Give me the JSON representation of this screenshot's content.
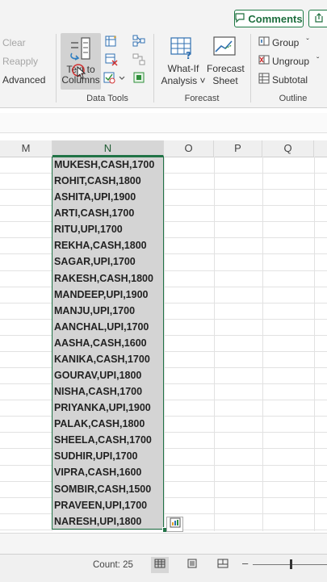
{
  "ribbon": {
    "comments_label": "Comments",
    "sort_filter": {
      "clear": "Clear",
      "reapply": "Reapply",
      "advanced": "Advanced"
    },
    "data_tools": {
      "label": "Data Tools",
      "text_to_columns_line1": "Text to",
      "text_to_columns_line2": "Columns"
    },
    "forecast": {
      "label": "Forecast",
      "what_if_line1": "What-If",
      "what_if_line2": "Analysis ˅",
      "forecast_sheet_line1": "Forecast",
      "forecast_sheet_line2": "Sheet"
    },
    "outline": {
      "label": "Outline",
      "group": "Group",
      "ungroup": "Ungroup",
      "subtotal": "Subtotal"
    }
  },
  "columns": [
    "M",
    "N",
    "O",
    "P",
    "Q"
  ],
  "cells": [
    "MUKESH,CASH,1700",
    "ROHIT,CASH,1800",
    "ASHITA,UPI,1900",
    "ARTI,CASH,1700",
    "RITU,UPI,1700",
    "REKHA,CASH,1800",
    "SAGAR,UPI,1700",
    "RAKESH,CASH,1800",
    "MANDEEP,UPI,1900",
    "MANJU,UPI,1700",
    "AANCHAL,UPI,1700",
    "AASHA,CASH,1600",
    "KANIKA,CASH,1700",
    "GOURAV,UPI,1800",
    "NISHA,CASH,1700",
    "PRIYANKA,UPI,1900",
    "PALAK,CASH,1800",
    "SHEELA,CASH,1700",
    "SUDHIR,UPI,1700",
    "VIPRA,CASH,1600",
    "SOMBIR,CASH,1500",
    "PRAVEEN,UPI,1700",
    "NARESH,UPI,1800"
  ],
  "status": {
    "count_text": "Count: 25"
  },
  "colors": {
    "accent": "#217346",
    "selection": "#d4d4d4"
  }
}
